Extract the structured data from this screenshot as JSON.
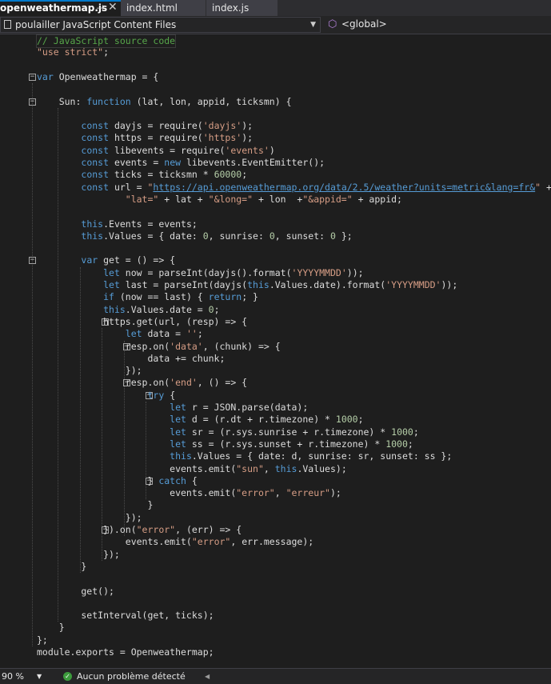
{
  "tabs": {
    "active": {
      "title": "openweathermap.js",
      "pin": "⊣",
      "close": "✕"
    },
    "others": [
      "index.html",
      "index.js"
    ]
  },
  "navbar": {
    "project": "poulailler JavaScript Content Files",
    "scope": "<global>"
  },
  "status": {
    "zoom": "90 %",
    "message": "Aucun problème détecté"
  },
  "colors": {
    "keyword": "#569cd6",
    "string": "#d69d85",
    "comment": "#57a64a",
    "number": "#b5cea8",
    "text": "#dcdcdc",
    "accent": "#007acc"
  },
  "code_lines": [
    [
      [
        "com",
        "// JavaScript source code"
      ]
    ],
    [
      [
        "str",
        "\"use strict\""
      ],
      [
        "txt",
        ";"
      ]
    ],
    [],
    [
      [
        "kw",
        "var"
      ],
      [
        "txt",
        " Openweathermap = {"
      ]
    ],
    [],
    [
      [
        "txt",
        "    Sun: "
      ],
      [
        "kw",
        "function"
      ],
      [
        "txt",
        " (lat, lon, appid, ticksmn) {"
      ]
    ],
    [],
    [
      [
        "txt",
        "        "
      ],
      [
        "kw",
        "const"
      ],
      [
        "txt",
        " dayjs = require("
      ],
      [
        "str",
        "'dayjs'"
      ],
      [
        "txt",
        ");"
      ]
    ],
    [
      [
        "txt",
        "        "
      ],
      [
        "kw",
        "const"
      ],
      [
        "txt",
        " https = require("
      ],
      [
        "str",
        "'https'"
      ],
      [
        "txt",
        ");"
      ]
    ],
    [
      [
        "txt",
        "        "
      ],
      [
        "kw",
        "const"
      ],
      [
        "txt",
        " libevents = require("
      ],
      [
        "str",
        "'events'"
      ],
      [
        "txt",
        ")"
      ]
    ],
    [
      [
        "txt",
        "        "
      ],
      [
        "kw",
        "const"
      ],
      [
        "txt",
        " events = "
      ],
      [
        "kw",
        "new"
      ],
      [
        "txt",
        " libevents.EventEmitter();"
      ]
    ],
    [
      [
        "txt",
        "        "
      ],
      [
        "kw",
        "const"
      ],
      [
        "txt",
        " ticks = ticksmn * "
      ],
      [
        "num",
        "60000"
      ],
      [
        "txt",
        ";"
      ]
    ],
    [
      [
        "txt",
        "        "
      ],
      [
        "kw",
        "const"
      ],
      [
        "txt",
        " url = "
      ],
      [
        "str",
        "\""
      ],
      [
        "link",
        "https://api.openweathermap.org/data/2.5/weather?units=metric&lang=fr&"
      ],
      [
        "str",
        "\""
      ],
      [
        "txt",
        " +"
      ]
    ],
    [
      [
        "txt",
        "                "
      ],
      [
        "str",
        "\"lat=\""
      ],
      [
        "txt",
        " + lat + "
      ],
      [
        "str",
        "\"&long=\""
      ],
      [
        "txt",
        " + lon  +"
      ],
      [
        "str",
        "\"&appid=\""
      ],
      [
        "txt",
        " + appid;"
      ]
    ],
    [],
    [
      [
        "txt",
        "        "
      ],
      [
        "kw",
        "this"
      ],
      [
        "txt",
        ".Events = events;"
      ]
    ],
    [
      [
        "txt",
        "        "
      ],
      [
        "kw",
        "this"
      ],
      [
        "txt",
        ".Values = { date: "
      ],
      [
        "num",
        "0"
      ],
      [
        "txt",
        ", sunrise: "
      ],
      [
        "num",
        "0"
      ],
      [
        "txt",
        ", sunset: "
      ],
      [
        "num",
        "0"
      ],
      [
        "txt",
        " };"
      ]
    ],
    [],
    [
      [
        "txt",
        "        "
      ],
      [
        "kw",
        "var"
      ],
      [
        "txt",
        " get = () => {"
      ]
    ],
    [
      [
        "txt",
        "            "
      ],
      [
        "kw",
        "let"
      ],
      [
        "txt",
        " now = parseInt(dayjs().format("
      ],
      [
        "str",
        "'YYYYMMDD'"
      ],
      [
        "txt",
        "));"
      ]
    ],
    [
      [
        "txt",
        "            "
      ],
      [
        "kw",
        "let"
      ],
      [
        "txt",
        " last = parseInt(dayjs("
      ],
      [
        "kw",
        "this"
      ],
      [
        "txt",
        ".Values.date).format("
      ],
      [
        "str",
        "'YYYYMMDD'"
      ],
      [
        "txt",
        "));"
      ]
    ],
    [
      [
        "txt",
        "            "
      ],
      [
        "kw",
        "if"
      ],
      [
        "txt",
        " (now == last) { "
      ],
      [
        "kw",
        "return"
      ],
      [
        "txt",
        "; }"
      ]
    ],
    [
      [
        "txt",
        "            "
      ],
      [
        "kw",
        "this"
      ],
      [
        "txt",
        ".Values.date = "
      ],
      [
        "num",
        "0"
      ],
      [
        "txt",
        ";"
      ]
    ],
    [
      [
        "txt",
        "            https.get(url, (resp) => {"
      ]
    ],
    [
      [
        "txt",
        "                "
      ],
      [
        "kw",
        "let"
      ],
      [
        "txt",
        " data = "
      ],
      [
        "str",
        "''"
      ],
      [
        "txt",
        ";"
      ]
    ],
    [
      [
        "txt",
        "                resp.on("
      ],
      [
        "str",
        "'data'"
      ],
      [
        "txt",
        ", (chunk) => {"
      ]
    ],
    [
      [
        "txt",
        "                    data += chunk;"
      ]
    ],
    [
      [
        "txt",
        "                });"
      ]
    ],
    [
      [
        "txt",
        "                resp.on("
      ],
      [
        "str",
        "'end'"
      ],
      [
        "txt",
        ", () => {"
      ]
    ],
    [
      [
        "txt",
        "                    "
      ],
      [
        "kw",
        "try"
      ],
      [
        "txt",
        " {"
      ]
    ],
    [
      [
        "txt",
        "                        "
      ],
      [
        "kw",
        "let"
      ],
      [
        "txt",
        " r = JSON.parse(data);"
      ]
    ],
    [
      [
        "txt",
        "                        "
      ],
      [
        "kw",
        "let"
      ],
      [
        "txt",
        " d = (r.dt + r.timezone) * "
      ],
      [
        "num",
        "1000"
      ],
      [
        "txt",
        ";"
      ]
    ],
    [
      [
        "txt",
        "                        "
      ],
      [
        "kw",
        "let"
      ],
      [
        "txt",
        " sr = (r.sys.sunrise + r.timezone) * "
      ],
      [
        "num",
        "1000"
      ],
      [
        "txt",
        ";"
      ]
    ],
    [
      [
        "txt",
        "                        "
      ],
      [
        "kw",
        "let"
      ],
      [
        "txt",
        " ss = (r.sys.sunset + r.timezone) * "
      ],
      [
        "num",
        "1000"
      ],
      [
        "txt",
        ";"
      ]
    ],
    [
      [
        "txt",
        "                        "
      ],
      [
        "kw",
        "this"
      ],
      [
        "txt",
        ".Values = { date: d, sunrise: sr, sunset: ss };"
      ]
    ],
    [
      [
        "txt",
        "                        events.emit("
      ],
      [
        "str",
        "\"sun\""
      ],
      [
        "txt",
        ", "
      ],
      [
        "kw",
        "this"
      ],
      [
        "txt",
        ".Values);"
      ]
    ],
    [
      [
        "txt",
        "                    } "
      ],
      [
        "kw",
        "catch"
      ],
      [
        "txt",
        " {"
      ]
    ],
    [
      [
        "txt",
        "                        events.emit("
      ],
      [
        "str",
        "\"error\""
      ],
      [
        "txt",
        ", "
      ],
      [
        "str",
        "\"erreur\""
      ],
      [
        "txt",
        ");"
      ]
    ],
    [
      [
        "txt",
        "                    }"
      ]
    ],
    [
      [
        "txt",
        "                });"
      ]
    ],
    [
      [
        "txt",
        "            }).on("
      ],
      [
        "str",
        "\"error\""
      ],
      [
        "txt",
        ", (err) => {"
      ]
    ],
    [
      [
        "txt",
        "                events.emit("
      ],
      [
        "str",
        "\"error\""
      ],
      [
        "txt",
        ", err.message);"
      ]
    ],
    [
      [
        "txt",
        "            });"
      ]
    ],
    [
      [
        "txt",
        "        }"
      ]
    ],
    [],
    [
      [
        "txt",
        "        get();"
      ]
    ],
    [],
    [
      [
        "txt",
        "        setInterval(get, ticks);"
      ]
    ],
    [
      [
        "txt",
        "    }"
      ]
    ],
    [
      [
        "txt",
        "};"
      ]
    ],
    [
      [
        "txt",
        "module.exports = Openweathermap;"
      ]
    ]
  ]
}
